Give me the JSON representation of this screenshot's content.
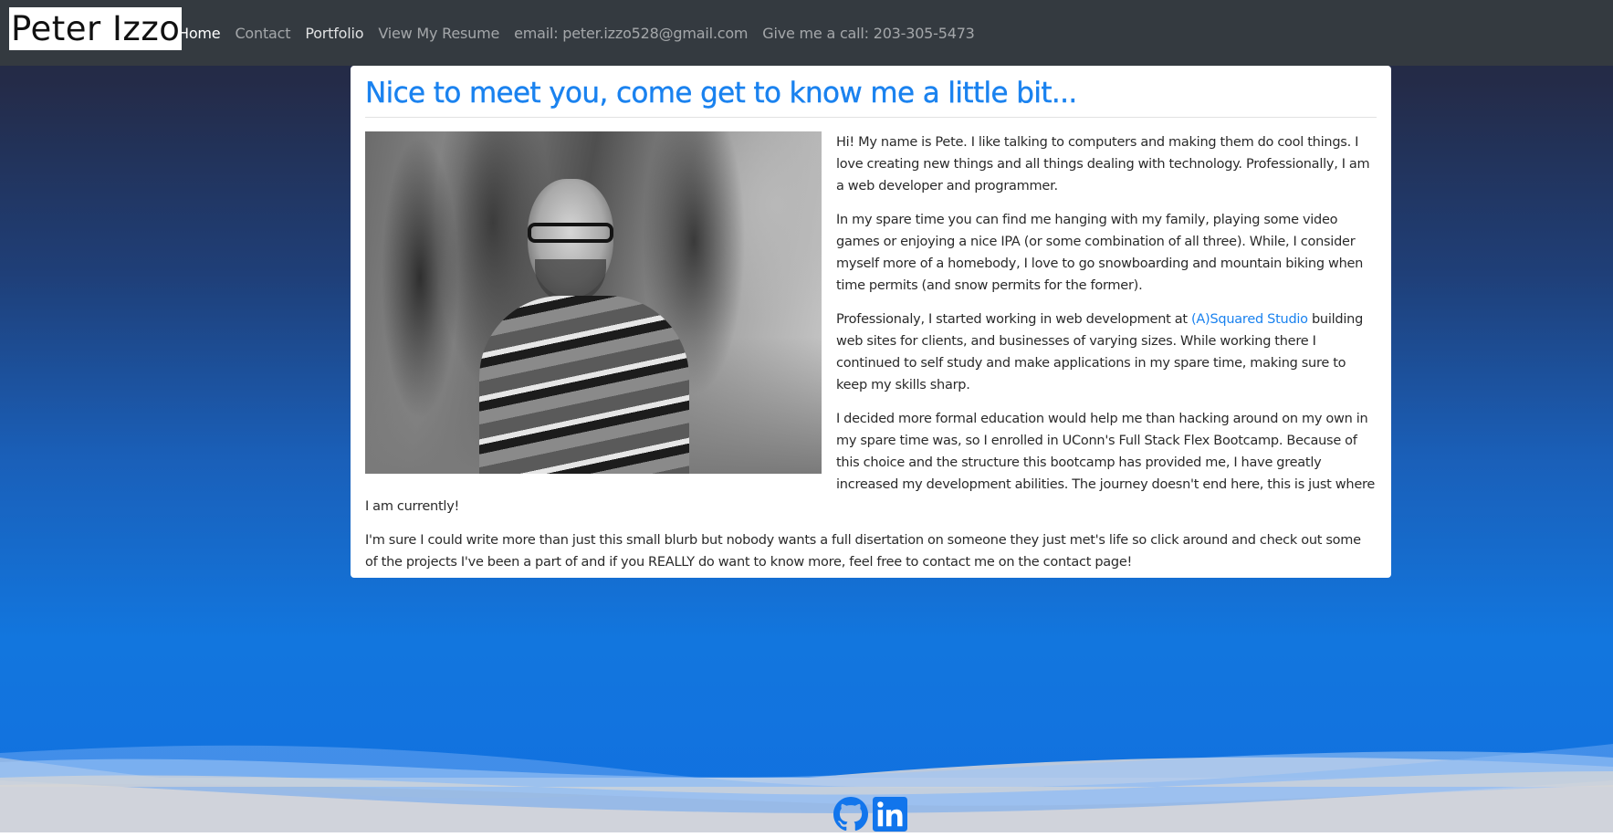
{
  "navbar": {
    "brand": "Peter Izzo",
    "links": [
      {
        "label": "Home"
      },
      {
        "label": "Contact"
      },
      {
        "label": "Portfolio"
      },
      {
        "label": "View My Resume"
      },
      {
        "label": "email: peter.izzo528@gmail.com"
      },
      {
        "label": "Give me a call: 203-305-5473"
      }
    ]
  },
  "about": {
    "heading": "Nice to meet you, come get to know me a little bit...",
    "p1": "Hi! My name is Pete. I like talking to computers and making them do cool things. I love creating new things and all things dealing with technology. Professionally, I am a web developer and programmer.",
    "p2": "In my spare time you can find me hanging with my family, playing some video games or enjoying a nice IPA (or some combination of all three). While, I consider myself more of a homebody, I love to go snowboarding and mountain biking when time permits (and snow permits for the former).",
    "p3_before": "Professionaly, I started working in web development at ",
    "p3_link": "(A)Squared Studio",
    "p3_after": " building web sites for clients, and businesses of varying sizes. While working there I continued to self study and make applications in my spare time, making sure to keep my skills sharp.",
    "p4": "I decided more formal education would help me than hacking around on my own in my spare time was, so I enrolled in UConn's Full Stack Flex Bootcamp. Because of this choice and the structure this bootcamp has provided me, I have greatly increased my development abilities. The journey doesn't end here, this is just where I am currently!",
    "p5": "I'm sure I could write more than just this small blurb but nobody wants a full disertation on someone they just met's life so click around and check out some of the projects I've been a part of and if you REALLY do want to know more, feel free to contact me on the contact page!"
  },
  "footer": {
    "icons": [
      "github-icon",
      "linkedin-icon"
    ]
  },
  "colors": {
    "navbar_bg": "#343a40",
    "accent": "#1a82ef",
    "footer_bg": "#d6d6d6"
  }
}
